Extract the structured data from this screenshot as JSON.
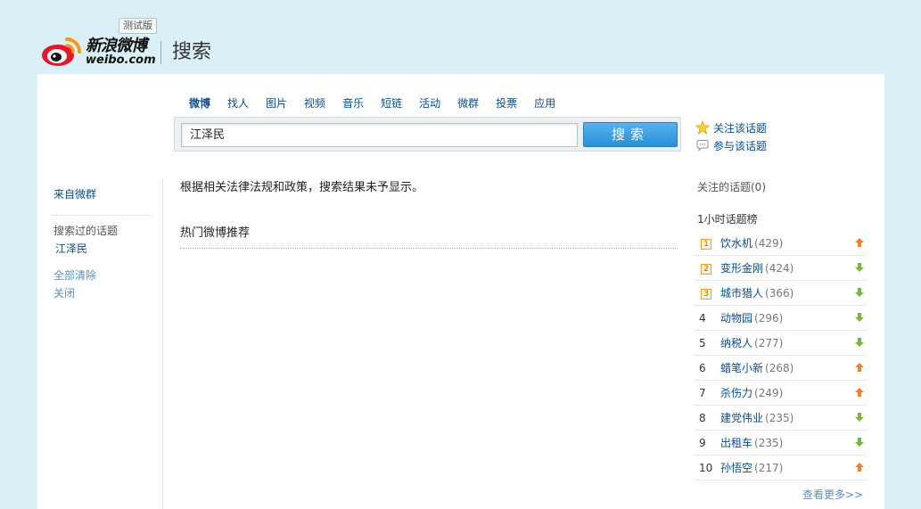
{
  "header": {
    "beta_badge": "测试版",
    "brand_cn": "新浪微博",
    "brand_en": "weibo.com",
    "page_title": "搜索"
  },
  "tabs": [
    {
      "label": "微博",
      "active": true
    },
    {
      "label": "找人",
      "active": false
    },
    {
      "label": "图片",
      "active": false
    },
    {
      "label": "视频",
      "active": false
    },
    {
      "label": "音乐",
      "active": false
    },
    {
      "label": "短链",
      "active": false
    },
    {
      "label": "活动",
      "active": false
    },
    {
      "label": "微群",
      "active": false
    },
    {
      "label": "投票",
      "active": false
    },
    {
      "label": "应用",
      "active": false
    }
  ],
  "search": {
    "value": "江泽民",
    "button_label": "搜索"
  },
  "topic_actions": {
    "follow": "关注该话题",
    "join": "参与该话题"
  },
  "sidebar": {
    "from_group": "来自微群",
    "searched_topics_label": "搜索过的话题",
    "searched_topic": "江泽民",
    "clear_all": "全部清除",
    "close": "关闭"
  },
  "content": {
    "notice": "根据相关法律法规和政策，搜索结果未予显示。",
    "hot_title": "热门微博推荐"
  },
  "right": {
    "followed_topics": "关注的话题(0)",
    "rank_title": "1小时话题榜",
    "more": "查看更多>>",
    "ranks": [
      {
        "num": "1",
        "name": "饮水机",
        "count": "(429)",
        "trend": "up"
      },
      {
        "num": "2",
        "name": "变形金刚",
        "count": "(424)",
        "trend": "down"
      },
      {
        "num": "3",
        "name": "城市猎人",
        "count": "(366)",
        "trend": "down"
      },
      {
        "num": "4",
        "name": "动物园",
        "count": "(296)",
        "trend": "down"
      },
      {
        "num": "5",
        "name": "纳税人",
        "count": "(277)",
        "trend": "down"
      },
      {
        "num": "6",
        "name": "蜡笔小新",
        "count": "(268)",
        "trend": "up"
      },
      {
        "num": "7",
        "name": "杀伤力",
        "count": "(249)",
        "trend": "up"
      },
      {
        "num": "8",
        "name": "建党伟业",
        "count": "(235)",
        "trend": "down"
      },
      {
        "num": "9",
        "name": "出租车",
        "count": "(235)",
        "trend": "down"
      },
      {
        "num": "10",
        "name": "孙悟空",
        "count": "(217)",
        "trend": "up"
      }
    ]
  },
  "colors": {
    "background": "#daf0f6",
    "link": "#0a4c8f",
    "button": "#2a8fd8",
    "trend_up": "#f08030",
    "trend_down": "#78b840"
  }
}
